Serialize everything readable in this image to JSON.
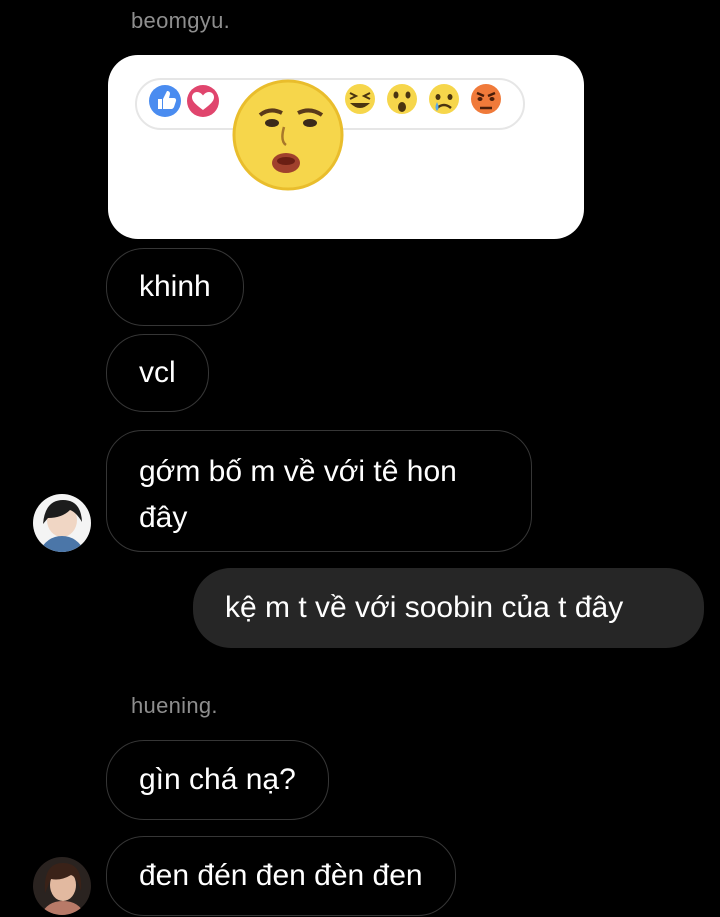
{
  "conversation": {
    "group1": {
      "sender": "beomgyu.",
      "messages": [
        "khinh",
        "vcl",
        "gớm bố m về với tê hon đây"
      ]
    },
    "reply": {
      "text": "kệ m t về với soobin của t đây"
    },
    "group2": {
      "sender": "huening.",
      "messages": [
        "gìn chá nạ?",
        "đen đén đen đèn đen"
      ]
    }
  },
  "colors": {
    "background": "#000000",
    "bubble_border": "#363636",
    "my_bubble": "#262626",
    "sender_name": "#8e8e8e",
    "text": "#ffffff"
  },
  "icons": {
    "reaction_strip": [
      "like-icon",
      "love-icon",
      "custom-face-icon",
      "haha-icon",
      "wow-icon",
      "sad-icon",
      "angry-icon"
    ]
  }
}
